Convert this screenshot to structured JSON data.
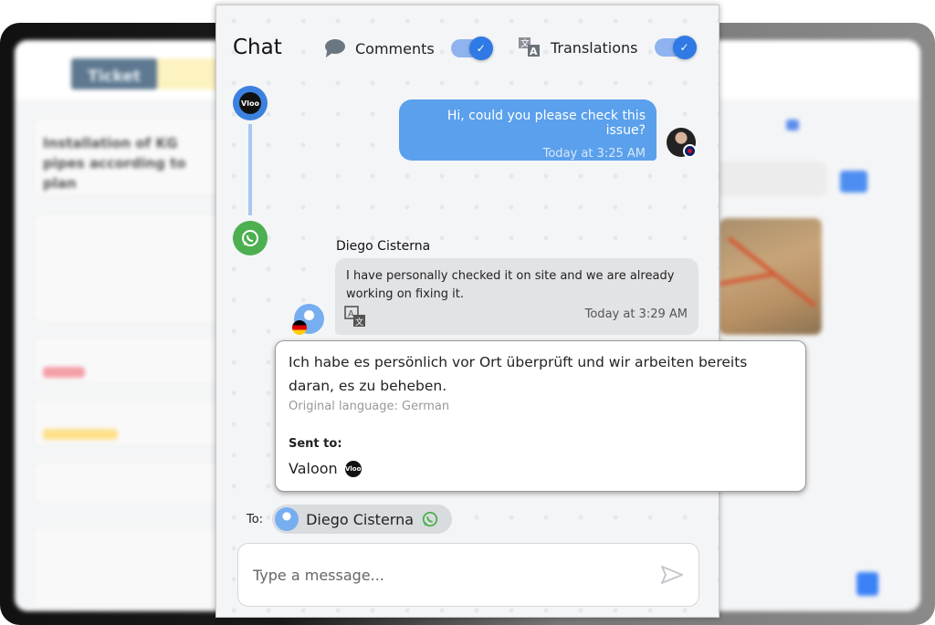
{
  "background": {
    "ticket_label": "Ticket",
    "title_field": "Installation of KG pipes according to plan",
    "colors": {
      "ticket": "#5d7890",
      "priority": "#f3a0a8",
      "status": "#fde08a"
    }
  },
  "chat": {
    "title": "Chat",
    "comments": {
      "label": "Comments",
      "icon": "speech-bubble-icon",
      "enabled": true
    },
    "translations": {
      "label": "Translations",
      "icon": "translate-icon",
      "enabled": true
    },
    "messages": [
      {
        "direction": "outgoing",
        "text": "Hi, could you please check this issue?",
        "time": "Today at 3:25 AM",
        "source": "valoon",
        "flag": "uk-flag"
      },
      {
        "direction": "incoming",
        "sender": "Diego Cisterna",
        "text": "I have personally checked it on site and we are already working on fixing it.",
        "time": "Today at 3:29 AM",
        "source": "whatsapp",
        "flag": "germany-flag"
      }
    ],
    "translation_popup": {
      "text": "Ich habe es persönlich vor Ort überprüft und wir arbeiten bereits daran, es zu beheben.",
      "original_language": "Original language: German",
      "sent_to_label": "Sent to:",
      "sent_to": "Valoon",
      "logo": "vloo"
    },
    "to_label": "To:",
    "recipient": "Diego Cisterna",
    "input_placeholder": "Type a message...",
    "accent": "#2f7ae5",
    "outgoing_bubble": "#5aa0ec",
    "whatsapp_color": "#4caf50"
  }
}
